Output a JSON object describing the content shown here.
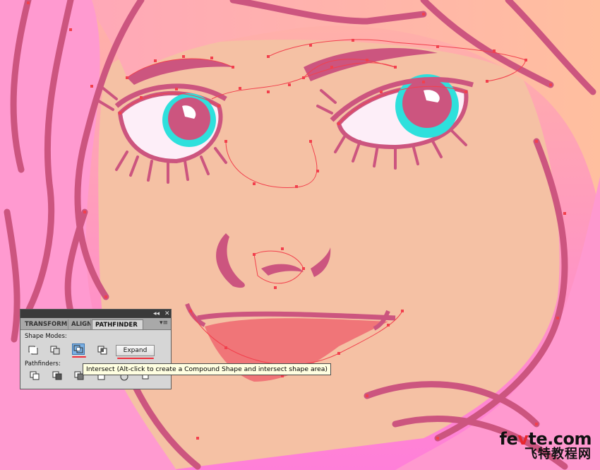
{
  "colors": {
    "skin": "#f5c1a4",
    "hair": "#ff8fcf",
    "outline": "#cc557f",
    "path": "#f2404d",
    "iris": "#2ee0dc",
    "lips": "#ef6d73"
  },
  "panel": {
    "tabs": [
      "TRANSFORM",
      "ALIGN",
      "PATHFINDER"
    ],
    "active_tab": "PATHFINDER",
    "collapse_icon": "double-left-arrow-icon",
    "close_icon": "close-icon",
    "menu_icon": "panel-menu-icon",
    "shape_modes_label": "Shape Modes:",
    "shape_mode_buttons": [
      "unite-icon",
      "minus-front-icon",
      "intersect-icon",
      "exclude-icon"
    ],
    "selected_mode": "intersect-icon",
    "expand_label": "Expand",
    "pathfinders_label": "Pathfinders:",
    "pathfinder_buttons": [
      "divide-icon",
      "trim-icon",
      "merge-icon",
      "crop-icon",
      "outline-icon",
      "minus-back-icon"
    ]
  },
  "tooltip": "Intersect (Alt-click to create a Compound Shape and intersect shape area)",
  "watermark": {
    "prefix": "fe",
    "accent": "v",
    "suffix": "te.com",
    "cn": "飞特教程网"
  }
}
